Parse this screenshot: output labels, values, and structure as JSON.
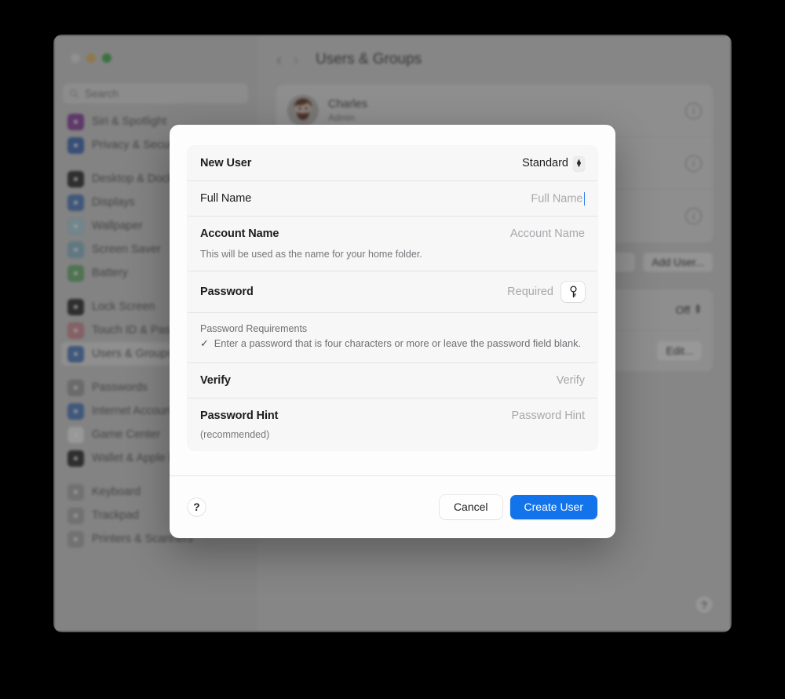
{
  "window": {
    "traffic_lights": [
      "close",
      "minimize",
      "zoom"
    ],
    "search": {
      "placeholder": "Search",
      "icon": "search-icon"
    }
  },
  "sidebar": {
    "groups": [
      {
        "items": [
          {
            "label": "Siri & Spotlight",
            "icon": "siri-icon",
            "color": "#b84bd6",
            "selected": false
          },
          {
            "label": "Privacy & Security",
            "icon": "privacy-hand-icon",
            "color": "#3d7ff0",
            "selected": false
          }
        ]
      },
      {
        "items": [
          {
            "label": "Desktop & Dock",
            "icon": "desktop-dock-icon",
            "color": "#4a4a4a",
            "selected": false
          },
          {
            "label": "Displays",
            "icon": "displays-icon",
            "color": "#4c8ff5",
            "selected": false
          },
          {
            "label": "Wallpaper",
            "icon": "wallpaper-icon",
            "color": "#9fd8ea",
            "selected": false
          },
          {
            "label": "Screen Saver",
            "icon": "screen-saver-icon",
            "color": "#7ec4e0",
            "selected": false
          },
          {
            "label": "Battery",
            "icon": "battery-icon",
            "color": "#5bc463",
            "selected": false
          }
        ]
      },
      {
        "items": [
          {
            "label": "Lock Screen",
            "icon": "lock-screen-icon",
            "color": "#4a4a4a",
            "selected": false
          },
          {
            "label": "Touch ID & Password",
            "icon": "touch-id-icon",
            "color": "#f4909c",
            "selected": false
          },
          {
            "label": "Users & Groups",
            "icon": "users-groups-icon",
            "color": "#4c8ff5",
            "selected": true
          }
        ]
      },
      {
        "items": [
          {
            "label": "Passwords",
            "icon": "passwords-key-icon",
            "color": "#a9a9ae",
            "selected": false
          },
          {
            "label": "Internet Accounts",
            "icon": "internet-accounts-icon",
            "color": "#4c8ff5",
            "selected": false
          },
          {
            "label": "Game Center",
            "icon": "game-center-icon",
            "color": "#f0f0f0",
            "selected": false
          },
          {
            "label": "Wallet & Apple Pay",
            "icon": "wallet-icon",
            "color": "#4a4a4a",
            "selected": false
          }
        ]
      },
      {
        "items": [
          {
            "label": "Keyboard",
            "icon": "keyboard-icon",
            "color": "#b4b4b9",
            "selected": false
          },
          {
            "label": "Trackpad",
            "icon": "trackpad-icon",
            "color": "#b4b4b9",
            "selected": false
          },
          {
            "label": "Printers & Scanners",
            "icon": "printers-scanners-icon",
            "color": "#b4b4b9",
            "selected": false
          }
        ]
      }
    ]
  },
  "toolbar": {
    "back_icon": "chevron-left-icon",
    "forward_icon": "chevron-right-icon",
    "title": "Users & Groups"
  },
  "users": [
    {
      "name": "Charles",
      "role": "Admin",
      "info_icon": "info-icon"
    },
    {
      "name": "",
      "role": "",
      "info_icon": "info-icon"
    },
    {
      "name": "",
      "role": "",
      "info_icon": "info-icon"
    }
  ],
  "content_actions": {
    "add_user_label": "Add User...",
    "auto_login_value": "Off",
    "edit_label": "Edit...",
    "help_label": "?"
  },
  "sheet": {
    "rows": {
      "new_user": {
        "label": "New User",
        "value": "Standard",
        "chevron_icon": "chevron-updown-icon"
      },
      "full_name": {
        "label": "Full Name",
        "placeholder": "Full Name",
        "value": ""
      },
      "account_name": {
        "label": "Account Name",
        "placeholder": "Account Name",
        "value": "",
        "description": "This will be used as the name for your home folder."
      },
      "password": {
        "label": "Password",
        "placeholder": "Required",
        "value": "",
        "key_icon": "key-icon"
      },
      "verify": {
        "label": "Verify",
        "placeholder": "Verify",
        "value": ""
      },
      "password_hint": {
        "label": "Password Hint",
        "placeholder": "Password Hint",
        "value": "",
        "description": "(recommended)"
      }
    },
    "requirements": {
      "title": "Password Requirements",
      "check_icon": "checkmark-icon",
      "text": "Enter a password that is four characters or more or leave the password field blank."
    },
    "footer": {
      "help_label": "?",
      "cancel_label": "Cancel",
      "create_label": "Create User",
      "primary_color": "#1273eb"
    }
  }
}
